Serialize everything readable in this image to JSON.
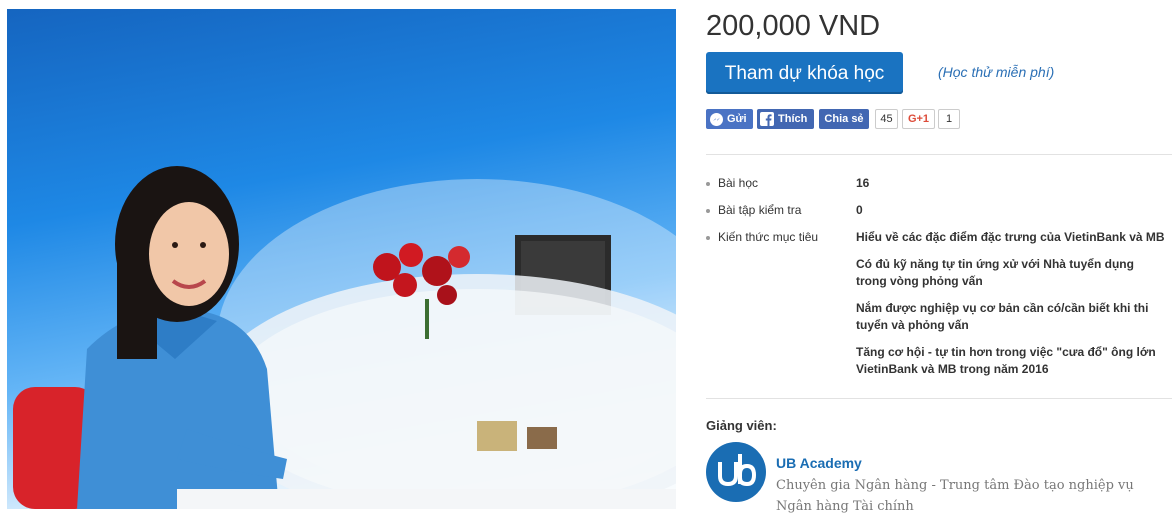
{
  "course": {
    "price": "200,000 VND",
    "enroll_label": "Tham dự khóa học",
    "trial_label": "(Học thử miễn phí)"
  },
  "social": {
    "send_label": "Gửi",
    "like_label": "Thích",
    "share_label": "Chia sẻ",
    "share_count": "45",
    "gplus_label": "G+1",
    "gplus_count": "1",
    "facebook_color": "#4267b2",
    "google_color": "#dd4b39"
  },
  "info": {
    "lessons_label": "Bài học",
    "lessons_value": "16",
    "tests_label": "Bài tập kiểm tra",
    "tests_value": "0",
    "objectives_label": "Kiến thức mục tiêu",
    "objectives": [
      "Hiểu về các đặc điểm đặc trưng của VietinBank và MB",
      "Có đủ kỹ năng tự tin ứng xử với Nhà tuyển dụng trong vòng phỏng vấn",
      "Nắm được nghiệp vụ cơ bản cần có/cần biết khi thi tuyển và phỏng vấn",
      "Tăng cơ hội - tự tin hơn trong việc \"cưa đổ\" ông lớn VietinBank và MB trong năm 2016"
    ]
  },
  "instructor": {
    "section_label": "Giảng viên:",
    "name": "UB Academy",
    "description": "Chuyên gia Ngân hàng - Trung tâm Đào tạo nghiệp vụ Ngân hàng Tài chính",
    "brand_color": "#1a6db3"
  },
  "colors": {
    "accent": "#1a73c1"
  }
}
